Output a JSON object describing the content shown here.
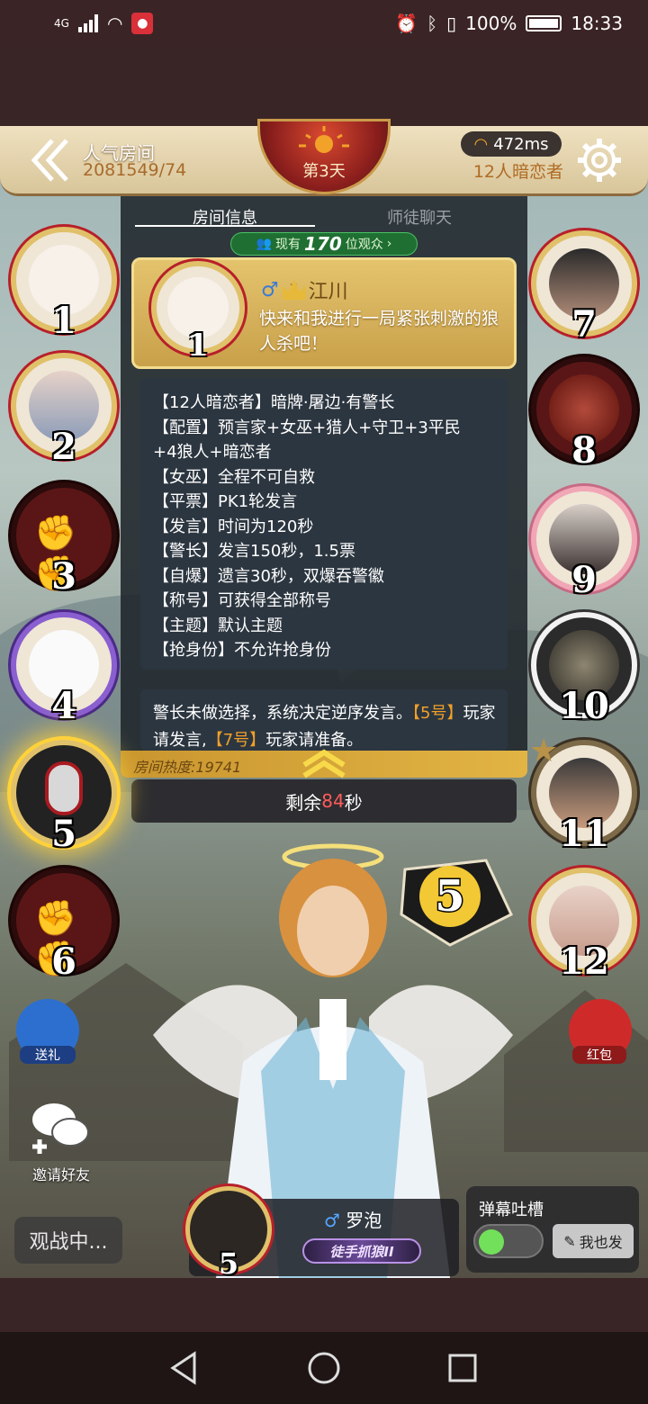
{
  "status_bar": {
    "network": "4G",
    "battery": "100%",
    "time": "18:33"
  },
  "header": {
    "room_type": "人气房间",
    "room_id": "2081549/74",
    "day": "第3天",
    "ping": "472ms",
    "mode": "12人暗恋者"
  },
  "panel": {
    "tabs": [
      "房间信息",
      "师徒聊天"
    ],
    "viewers_prefix": "现有",
    "viewers_count": "170",
    "viewers_suffix": "位观众",
    "host": {
      "name": "江川",
      "level": "7",
      "gender": "♂",
      "seat": "1",
      "message": "快来和我进行一局紧张刺激的狼人杀吧！"
    },
    "rules": [
      "【12人暗恋者】暗牌·屠边·有警长",
      "【配置】预言家+女巫+猎人+守卫+3平民",
      "+4狼人+暗恋者",
      "【女巫】全程不可自救",
      "【平票】PK1轮发言",
      "【发言】时间为120秒",
      "【警长】发言150秒，1.5票",
      "【自爆】遗言30秒，双爆吞警徽",
      "【称号】可获得全部称号",
      "【主题】默认主题",
      "【抢身份】不允许抢身份"
    ],
    "notice": {
      "part1": "警长未做选择，系统决定逆序发言。",
      "hl1": "【5号】",
      "part2": "玩家请发言,",
      "hl2": "【7号】",
      "part3": "玩家请准备。"
    },
    "heat_label": "房间热度:19741",
    "timer_prefix": "剩余",
    "timer_seconds": "84",
    "timer_suffix": "秒"
  },
  "seats_left": [
    "1",
    "2",
    "3",
    "4",
    "5",
    "6"
  ],
  "seats_right": [
    "7",
    "8",
    "9",
    "10",
    "11",
    "12"
  ],
  "speaking_seat": "5",
  "side_buttons": {
    "gift": "送礼",
    "redpack": "红包",
    "invite": "邀请好友",
    "spectate": "观战中..."
  },
  "current_player": {
    "seat": "5",
    "gender": "♂",
    "name": "罗泡",
    "title": "徒手抓狼II"
  },
  "float_badge_number": "5",
  "barrage": {
    "title": "弹幕吐槽",
    "send": "我也发",
    "enabled": true
  }
}
